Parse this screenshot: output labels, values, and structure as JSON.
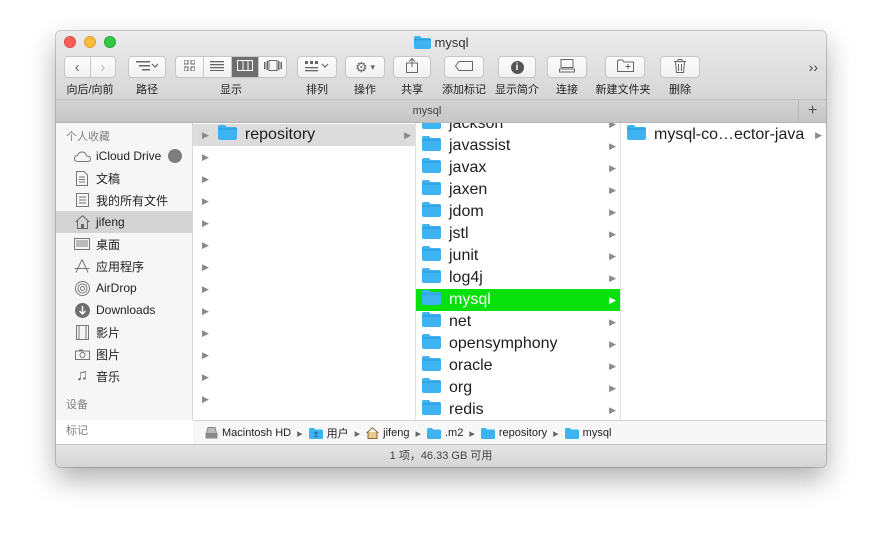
{
  "window": {
    "title": "mysql"
  },
  "toolbar": {
    "buttons": [
      {
        "label": "向后/向前"
      },
      {
        "label": "路径"
      },
      {
        "label": "显示"
      },
      {
        "label": "排列"
      },
      {
        "label": "操作"
      },
      {
        "label": "共享"
      },
      {
        "label": "添加标记"
      },
      {
        "label": "显示简介"
      },
      {
        "label": "连接"
      },
      {
        "label": "新建文件夹"
      },
      {
        "label": "删除"
      }
    ],
    "overflow": "››"
  },
  "tabbar": {
    "title": "mysql",
    "add": "+"
  },
  "sidebar": {
    "sections": [
      {
        "header": "个人收藏"
      },
      {
        "header": "设备"
      },
      {
        "header": "标记"
      }
    ],
    "items": [
      {
        "label": "iCloud Drive",
        "icon": "cloud-icon"
      },
      {
        "label": "文稿",
        "icon": "document-icon"
      },
      {
        "label": "我的所有文件",
        "icon": "all-files-icon"
      },
      {
        "label": "jifeng",
        "icon": "home-icon"
      },
      {
        "label": "桌面",
        "icon": "desktop-icon"
      },
      {
        "label": "应用程序",
        "icon": "applications-icon"
      },
      {
        "label": "AirDrop",
        "icon": "airdrop-icon"
      },
      {
        "label": "Downloads",
        "icon": "downloads-icon"
      },
      {
        "label": "影片",
        "icon": "movies-icon"
      },
      {
        "label": "图片",
        "icon": "pictures-icon"
      },
      {
        "label": "音乐",
        "icon": "music-icon"
      }
    ]
  },
  "columns": {
    "col1": [
      {
        "name": "repository"
      }
    ],
    "col2": [
      {
        "name": "jackson"
      },
      {
        "name": "javassist"
      },
      {
        "name": "javax"
      },
      {
        "name": "jaxen"
      },
      {
        "name": "jdom"
      },
      {
        "name": "jstl"
      },
      {
        "name": "junit"
      },
      {
        "name": "log4j"
      },
      {
        "name": "mysql"
      },
      {
        "name": "net"
      },
      {
        "name": "opensymphony"
      },
      {
        "name": "oracle"
      },
      {
        "name": "org"
      },
      {
        "name": "redis"
      }
    ],
    "col3": [
      {
        "name": "mysql-co…ector-java"
      }
    ]
  },
  "pathbar": [
    {
      "label": "Macintosh HD"
    },
    {
      "label": "用户"
    },
    {
      "label": "jifeng"
    },
    {
      "label": ".m2"
    },
    {
      "label": "repository"
    },
    {
      "label": "mysql"
    }
  ],
  "status": "1 项，46.33 GB 可用",
  "colors": {
    "folder": "#3db3f2",
    "selection": "#08e00c"
  }
}
